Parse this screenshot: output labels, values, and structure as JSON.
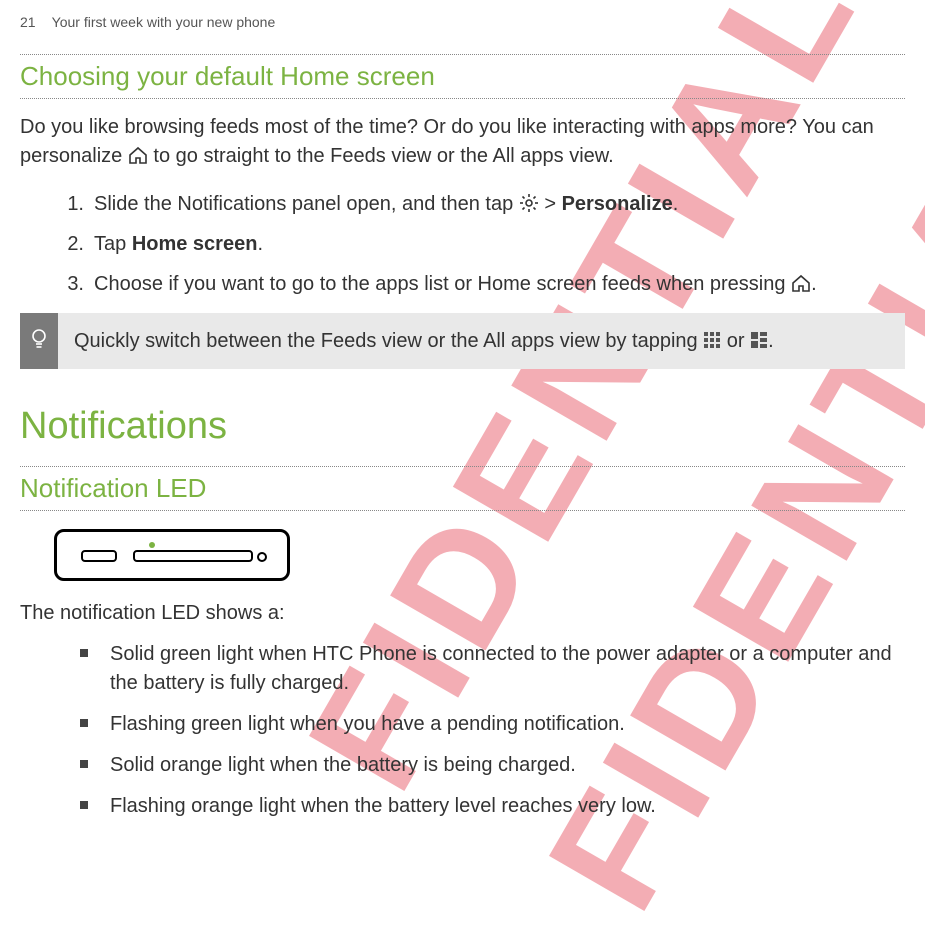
{
  "page": {
    "number": "21",
    "title": "Your first week with your new phone"
  },
  "section1": {
    "heading": "Choosing your default Home screen",
    "intro_a": "Do you like browsing feeds most of the time? Or do you like interacting with apps more? You can personalize ",
    "intro_b": " to go straight to the Feeds view or the All apps view.",
    "steps": {
      "s1a": "Slide the Notifications panel open, and then tap ",
      "s1b": " > ",
      "s1c": "Personalize",
      "s1d": ".",
      "s2a": "Tap ",
      "s2b": "Home screen",
      "s2c": ".",
      "s3a": "Choose if you want to go to the apps list or Home screen feeds when pressing ",
      "s3b": "."
    },
    "tip_a": "Quickly switch between the Feeds view or the All apps view by tapping ",
    "tip_b": " or ",
    "tip_c": "."
  },
  "section2": {
    "heading": "Notifications",
    "sub": "Notification LED",
    "intro": "The notification LED shows a:",
    "bullets": [
      "Solid green light when HTC Phone is connected to the power adapter or a computer and the battery is fully charged.",
      "Flashing green light when you have a pending notification.",
      "Solid orange light when the battery is being charged.",
      "Flashing orange light when the battery level reaches very low."
    ]
  },
  "watermark": "FIDENTIAL"
}
